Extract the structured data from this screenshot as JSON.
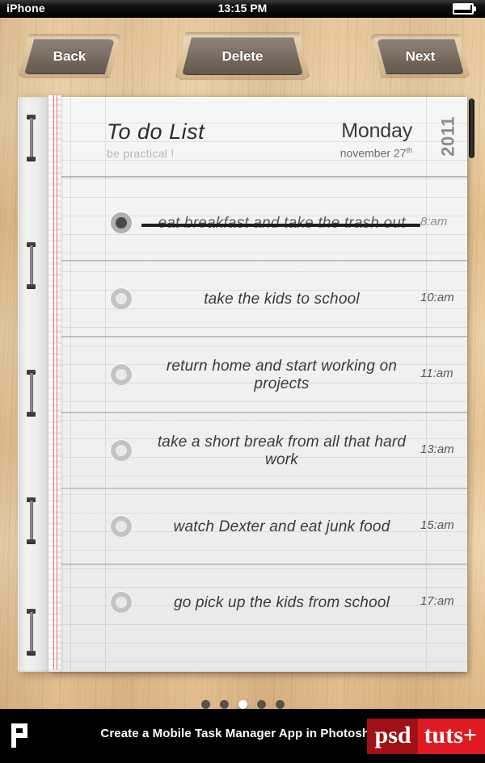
{
  "statusbar": {
    "carrier": "iPhone",
    "time": "13:15 PM",
    "battery_icon": "battery-icon"
  },
  "toolbar": {
    "back_label": "Back",
    "delete_label": "Delete",
    "next_label": "Next"
  },
  "notepad": {
    "title": "To do List",
    "subtitle": "be practical !",
    "day": "Monday",
    "date_month_day": "november 27",
    "date_ordinal": "th",
    "year": "2011"
  },
  "tasks": [
    {
      "text": "eat breakfast and take the trash out",
      "time": "8:am",
      "done": true
    },
    {
      "text": "take the kids to school",
      "time": "10:am",
      "done": false
    },
    {
      "text": "return home and start working on projects",
      "time": "11:am",
      "done": false
    },
    {
      "text": "take a short break from all that hard work",
      "time": "13:am",
      "done": false
    },
    {
      "text": "watch Dexter and eat junk food",
      "time": "15:am",
      "done": false
    },
    {
      "text": "go pick up the kids from school",
      "time": "17:am",
      "done": false
    }
  ],
  "pagination": {
    "count": 5,
    "active_index": 2
  },
  "footer": {
    "logo_letter": "P",
    "title": "Create a Mobile Task Manager App in Photoshop",
    "brand_left": "psd",
    "brand_right": "tuts+"
  },
  "colors": {
    "wood": "#e6c394",
    "paper": "#f2f2f2",
    "button": "#7d7167",
    "accent_red": "#e01a21",
    "accent_dark_red": "#a01015",
    "margin_red": "#d63c3c",
    "ink": "#3a3a3a"
  }
}
